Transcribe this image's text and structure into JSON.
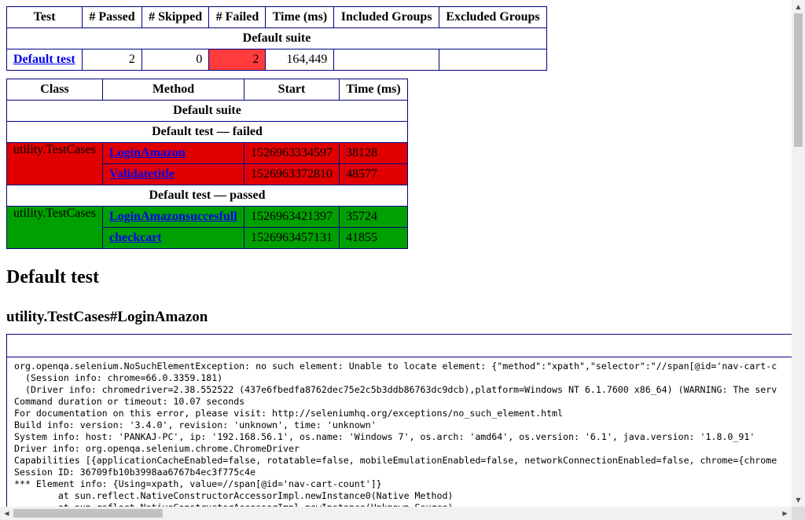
{
  "summary": {
    "headers": [
      "Test",
      "# Passed",
      "# Skipped",
      "# Failed",
      "Time (ms)",
      "Included Groups",
      "Excluded Groups"
    ],
    "suite_label": "Default suite",
    "row": {
      "test": "Default test",
      "passed": "2",
      "skipped": "0",
      "failed": "2",
      "time": "164,449",
      "included": "",
      "excluded": ""
    }
  },
  "methods": {
    "headers": [
      "Class",
      "Method",
      "Start",
      "Time (ms)"
    ],
    "suite_label": "Default suite",
    "failed_label": "Default test — failed",
    "passed_label": "Default test — passed",
    "failed": {
      "class": "utility.TestCases",
      "rows": [
        {
          "method": "LoginAmazon",
          "start": "1526963334597",
          "time": "38128"
        },
        {
          "method": "Validatetitle",
          "start": "1526963372810",
          "time": "48577"
        }
      ]
    },
    "passed": {
      "class": "utility.TestCases",
      "rows": [
        {
          "method": "LoginAmazonsuccesfull",
          "start": "1526963421397",
          "time": "35724"
        },
        {
          "method": "checkcart",
          "start": "1526963457131",
          "time": "41855"
        }
      ]
    }
  },
  "detail": {
    "title": "Default test",
    "subtitle": "utility.TestCases#LoginAmazon",
    "error_text": "org.openqa.selenium.NoSuchElementException: no such element: Unable to locate element: {\"method\":\"xpath\",\"selector\":\"//span[@id='nav-cart-c\n  (Session info: chrome=66.0.3359.181)\n  (Driver info: chromedriver=2.38.552522 (437e6fbedfa8762dec75e2c5b3ddb86763dc9dcb),platform=Windows NT 6.1.7600 x86_64) (WARNING: The serv\nCommand duration or timeout: 10.07 seconds\nFor documentation on this error, please visit: http://seleniumhq.org/exceptions/no_such_element.html\nBuild info: version: '3.4.0', revision: 'unknown', time: 'unknown'\nSystem info: host: 'PANKAJ-PC', ip: '192.168.56.1', os.name: 'Windows 7', os.arch: 'amd64', os.version: '6.1', java.version: '1.8.0_91'\nDriver info: org.openqa.selenium.chrome.ChromeDriver\nCapabilities [{applicationCacheEnabled=false, rotatable=false, mobileEmulationEnabled=false, networkConnectionEnabled=false, chrome={chrome\nSession ID: 36709fb10b3998aa6767b4ec3f775c4e\n*** Element info: {Using=xpath, value=//span[@id='nav-cart-count']}\n\tat sun.reflect.NativeConstructorAccessorImpl.newInstance0(Native Method)\n\tat sun.reflect.NativeConstructorAccessorImpl.newInstance(Unknown Source)"
  },
  "colors": {
    "failed_row": "#e00000",
    "passed_row": "#00a000",
    "failed_count_cell": "#ff3b3b",
    "table_border": "#000080",
    "link": "#0000ee"
  },
  "icons": {
    "scroll_up": "triangle-up-icon",
    "scroll_down": "triangle-down-icon",
    "scroll_left": "triangle-left-icon",
    "scroll_right": "triangle-right-icon"
  }
}
